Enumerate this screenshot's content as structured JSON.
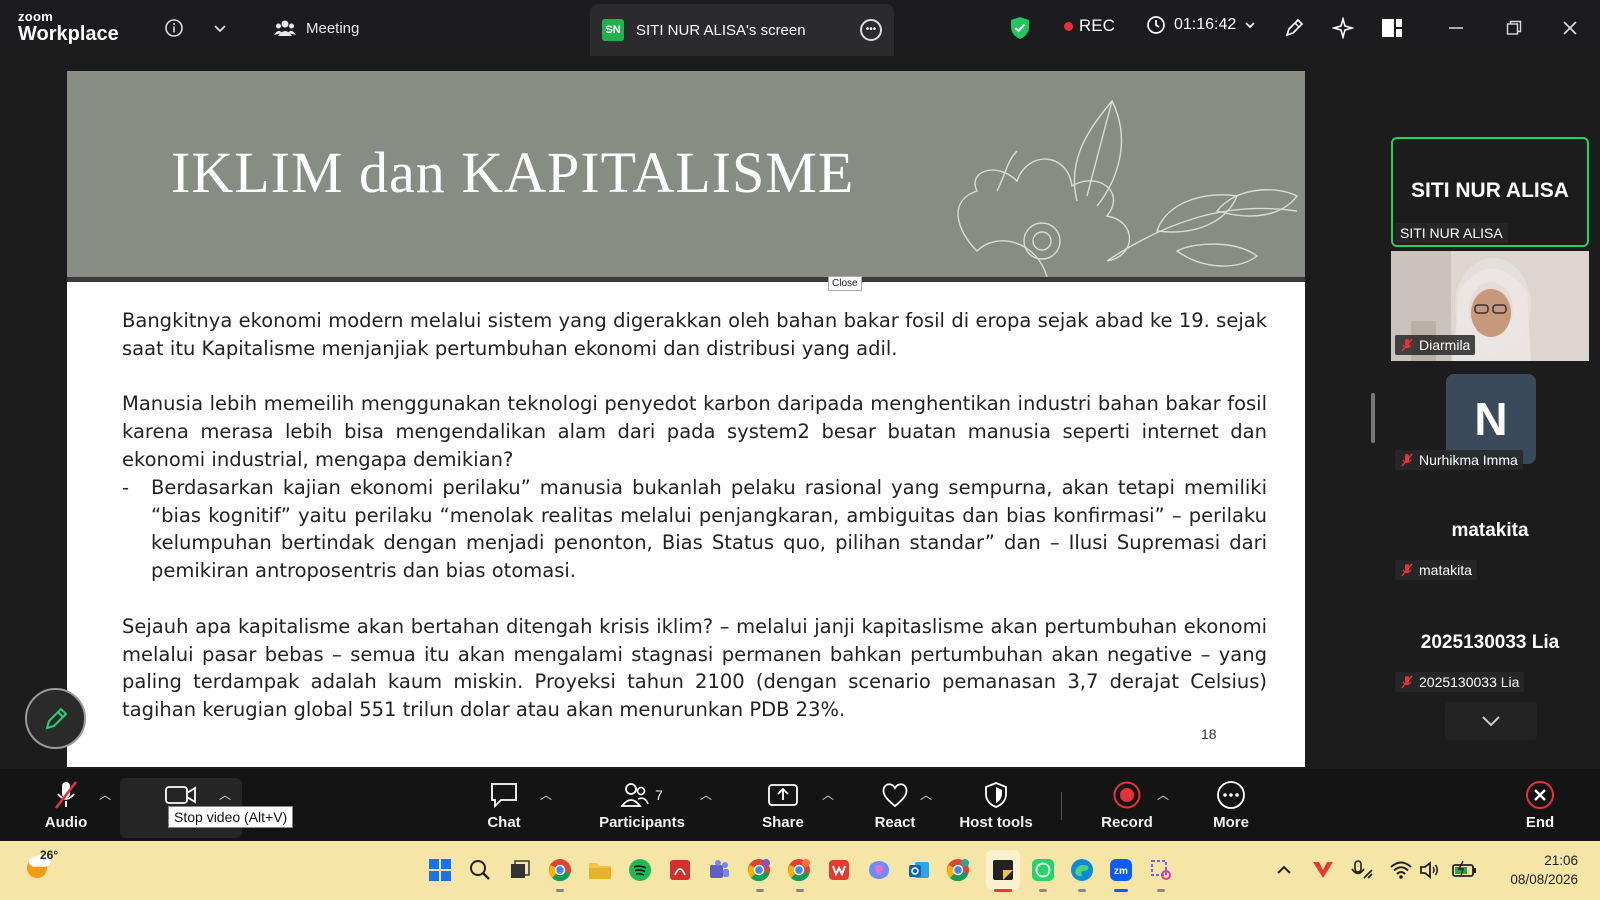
{
  "app": {
    "logo_small": "zoom",
    "logo_big": "Workplace"
  },
  "topbar": {
    "meeting_label": "Meeting",
    "screen_tab_badge": "SN",
    "screen_tab_label": "SITI NUR ALISA's screen",
    "rec_label": "REC",
    "timer": "01:16:42"
  },
  "slide": {
    "title": "IKLIM dan KAPITALISME",
    "close_tip": "Close",
    "paragraph1": "Bangkitnya ekonomi modern melalui sistem yang digerakkan oleh bahan bakar fosil di eropa sejak abad ke 19. sejak saat itu Kapitalisme menjanjiak pertumbuhan ekonomi dan distribusi yang adil.",
    "paragraph2": "Manusia lebih memeilih menggunakan teknologi penyedot karbon daripada menghentikan industri bahan bakar fosil karena merasa lebih bisa mengendalikan alam dari pada system2 besar buatan manusia seperti  internet dan ekonomi industrial, mengapa demikian?",
    "bullet_dash": "-",
    "bullet1": "Berdasarkan kajian ekonomi perilaku” manusia bukanlah pelaku rasional yang sempurna, akan tetapi memiliki “bias kognitif” yaitu perilaku “menolak realitas melalui penjangkaran, ambiguitas dan bias konfirmasi” – perilaku kelumpuhan bertindak dengan menjadi penonton, Bias Status quo, pilihan standar” dan – Ilusi Supremasi dari pemikiran antroposentris dan bias otomasi.",
    "paragraph3": "Sejauh apa kapitalisme akan bertahan ditengah krisis iklim? – melalui janji kapitaslisme akan pertumbuhan ekonomi melalui pasar bebas – semua itu akan mengalami stagnasi permanen bahkan pertumbuhan akan negative – yang paling terdampak adalah kaum miskin. Proyeksi tahun 2100 (dengan scenario pemanasan 3,7 derajat Celsius) tagihan kerugian global 551 trilun dolar atau akan menurunkan PDB 23%.",
    "page_number": "18"
  },
  "participants": [
    {
      "big_name": "SITI NUR ALISA",
      "label": "SITI NUR ALISA"
    },
    {
      "label": "Diarmila"
    },
    {
      "avatar_letter": "N",
      "label": "Nurhikma Imma"
    },
    {
      "big_name": "matakita",
      "label": "matakita"
    },
    {
      "big_name": "2025130033 Lia",
      "label": "2025130033 Lia"
    }
  ],
  "toolbar": {
    "audio": "Audio",
    "video": "V",
    "video_tooltip": "Stop video (Alt+V)",
    "chat": "Chat",
    "participants": "Participants",
    "participants_count": "7",
    "share": "Share",
    "react": "React",
    "host_tools": "Host tools",
    "record": "Record",
    "more": "More",
    "end": "End"
  },
  "taskbar": {
    "temperature": "26°",
    "time": "21:06",
    "date": "08/08/2026"
  },
  "colors": {
    "slide_header": "#888d84",
    "active_border": "#23d160",
    "rec_red": "#e8303a",
    "taskbar_bg": "#f5e6a8"
  }
}
